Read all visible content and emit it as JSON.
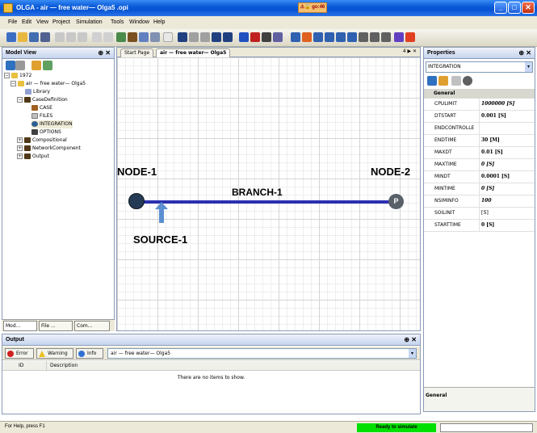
{
  "window": {
    "title": "OLGA - air — free water— Olga5 .opi",
    "badge": "⚠🔒 go:46"
  },
  "menu": [
    "File",
    "Edit",
    "View",
    "Project",
    "Simulation",
    "Tools",
    "Window",
    "Help"
  ],
  "model_view": {
    "title": "Model View",
    "tree": [
      {
        "label": "1972",
        "icon": "folder-icon"
      },
      {
        "label": "air — free water— Olga5",
        "icon": "folder-icon"
      },
      {
        "label": "Library",
        "icon": "library-icon"
      },
      {
        "label": "CaseDefinition",
        "icon": "folder-icon"
      },
      {
        "label": "CASE",
        "icon": "case-icon"
      },
      {
        "label": "FILES",
        "icon": "files-icon"
      },
      {
        "label": "INTEGRATION",
        "icon": "integration-icon"
      },
      {
        "label": "OPTIONS",
        "icon": "options-icon"
      },
      {
        "label": "Compositional",
        "icon": "folder-icon"
      },
      {
        "label": "NetworkComponent",
        "icon": "folder-icon"
      },
      {
        "label": "Output",
        "icon": "folder-icon"
      }
    ],
    "bottom_tabs": [
      "Mod...",
      "File ...",
      "Com..."
    ]
  },
  "document": {
    "tabs": [
      "Start Page",
      "air — free water— Olga5"
    ],
    "controls": "4 ▶ ✕",
    "node1": "NODE-1",
    "node2": "NODE-2",
    "node2_marker": "P",
    "branch": "BRANCH-1",
    "source": "SOURCE-1"
  },
  "properties": {
    "title": "Properties",
    "selector": "INTEGRATION",
    "category": "General",
    "rows": [
      {
        "key": "CPULIMIT",
        "value": "1000000 [S]",
        "italic": true
      },
      {
        "key": "DTSTART",
        "value": "0.001 [S]",
        "italic": false
      },
      {
        "key": "ENDCONTROLLE",
        "value": "",
        "italic": false
      },
      {
        "key": "ENDTIME",
        "value": "30 [M]",
        "italic": false
      },
      {
        "key": "MAXDT",
        "value": "0.01 [S]",
        "italic": false
      },
      {
        "key": "MAXTIME",
        "value": "0 [S]",
        "italic": true
      },
      {
        "key": "MINDT",
        "value": "0.0001 [S]",
        "italic": false
      },
      {
        "key": "MINTIME",
        "value": "0 [S]",
        "italic": true
      },
      {
        "key": "NSIMINFO",
        "value": "100",
        "italic": true
      },
      {
        "key": "SOILINIT",
        "value": "[S]",
        "italic": false
      },
      {
        "key": "STARTTIME",
        "value": "0 [S]",
        "italic": false
      }
    ],
    "description": "General"
  },
  "output": {
    "title": "Output",
    "filters": [
      "Error",
      "Warning",
      "Info"
    ],
    "source": "air — free water— Olga5",
    "columns": [
      "ID",
      "Description"
    ],
    "empty": "There are no items to show."
  },
  "status": {
    "help": "For Help, press F1",
    "state": "Ready to simulate",
    "state_color": "#00e000"
  }
}
